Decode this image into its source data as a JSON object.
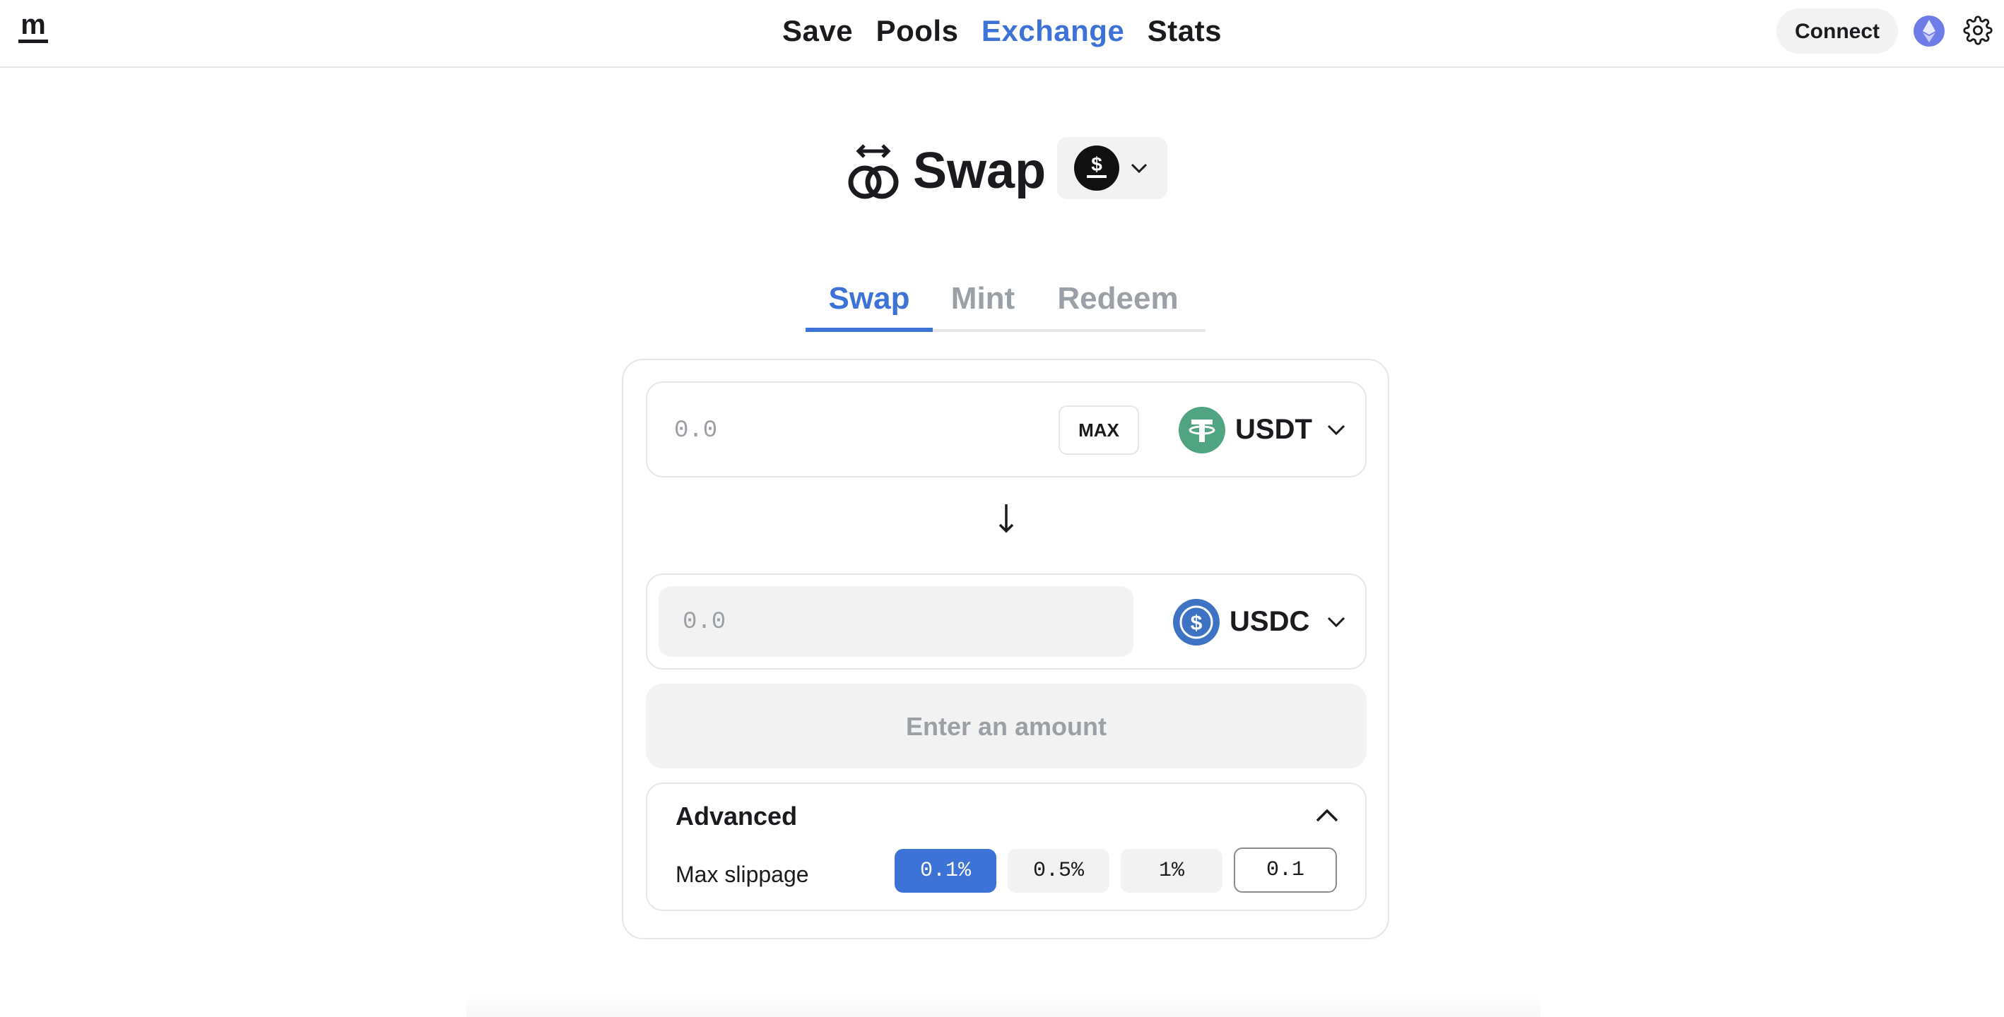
{
  "nav": {
    "items": [
      {
        "label": "Save",
        "active": false
      },
      {
        "label": "Pools",
        "active": false
      },
      {
        "label": "Exchange",
        "active": true
      },
      {
        "label": "Stats",
        "active": false
      }
    ],
    "connect_label": "Connect",
    "logo_text": "m",
    "network_icon": "ethereum-icon",
    "settings_icon": "gear-icon"
  },
  "heading": {
    "title": "Swap",
    "icon": "swap-rings-icon",
    "asset_icon": "dollar-coin-icon"
  },
  "tabs": [
    {
      "label": "Swap",
      "active": true
    },
    {
      "label": "Mint",
      "active": false
    },
    {
      "label": "Redeem",
      "active": false
    }
  ],
  "from": {
    "placeholder": "0.0",
    "max_label": "MAX",
    "token": "USDT",
    "token_icon": "tether-icon",
    "token_color": "#50a482"
  },
  "to": {
    "placeholder": "0.0",
    "token": "USDC",
    "token_icon": "usdc-icon",
    "token_color": "#3e73c4"
  },
  "submit_label": "Enter an amount",
  "advanced": {
    "title": "Advanced",
    "slippage_label": "Max slippage",
    "options": [
      {
        "label": "0.1%",
        "active": true
      },
      {
        "label": "0.5%",
        "active": false
      },
      {
        "label": "1%",
        "active": false
      }
    ],
    "custom_value": "0.1"
  },
  "colors": {
    "accent": "#3d72d6",
    "muted": "#9aa0a6",
    "surface": "#f2f2f2"
  }
}
